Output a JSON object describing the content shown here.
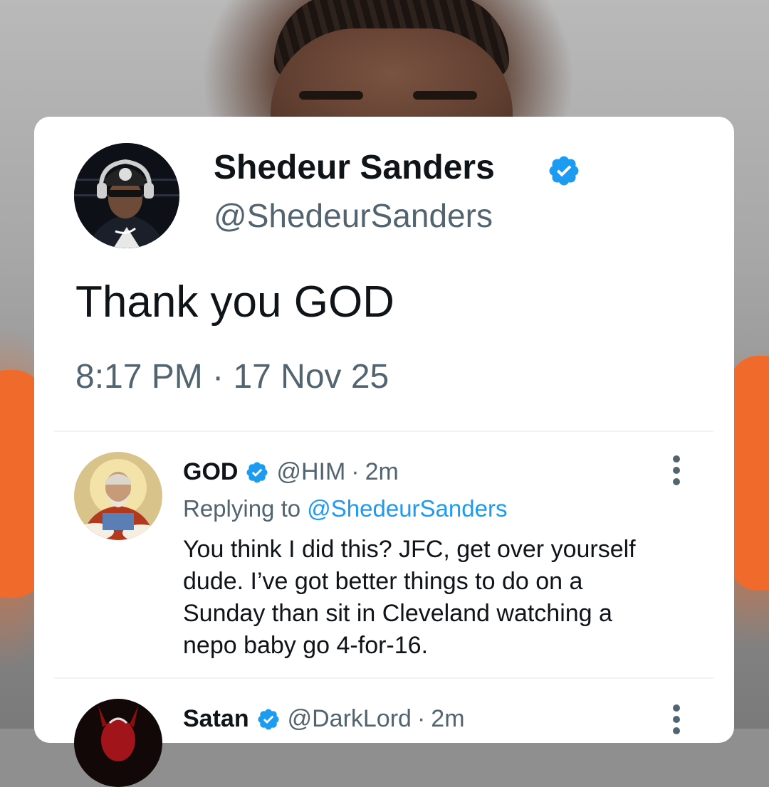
{
  "tweet": {
    "author_name": "Shedeur Sanders",
    "author_handle": "@ShedeurSanders",
    "text": "Thank you GOD",
    "time": "8:17 PM",
    "separator": "·",
    "date": "17 Nov 25"
  },
  "replies": [
    {
      "name": "GOD",
      "handle": "@HIM",
      "time": "2m",
      "replying_prefix": "Replying to",
      "replying_to": "@ShedeurSanders",
      "body_lines": [
        "You think I did this? JFC, get over yourself",
        "dude. I’ve got better things to do on a",
        "Sunday than sit in Cleveland watching a",
        "nepo baby go 4-for-16."
      ]
    },
    {
      "name": "Satan",
      "handle": "@DarkLord",
      "time": "2m"
    }
  ],
  "colors": {
    "verified": "#1d9bf0",
    "link": "#1d9bf0",
    "text_primary": "#0f1419",
    "text_secondary": "#536471"
  },
  "icons": [
    "verified-badge-icon",
    "more-options-icon"
  ]
}
